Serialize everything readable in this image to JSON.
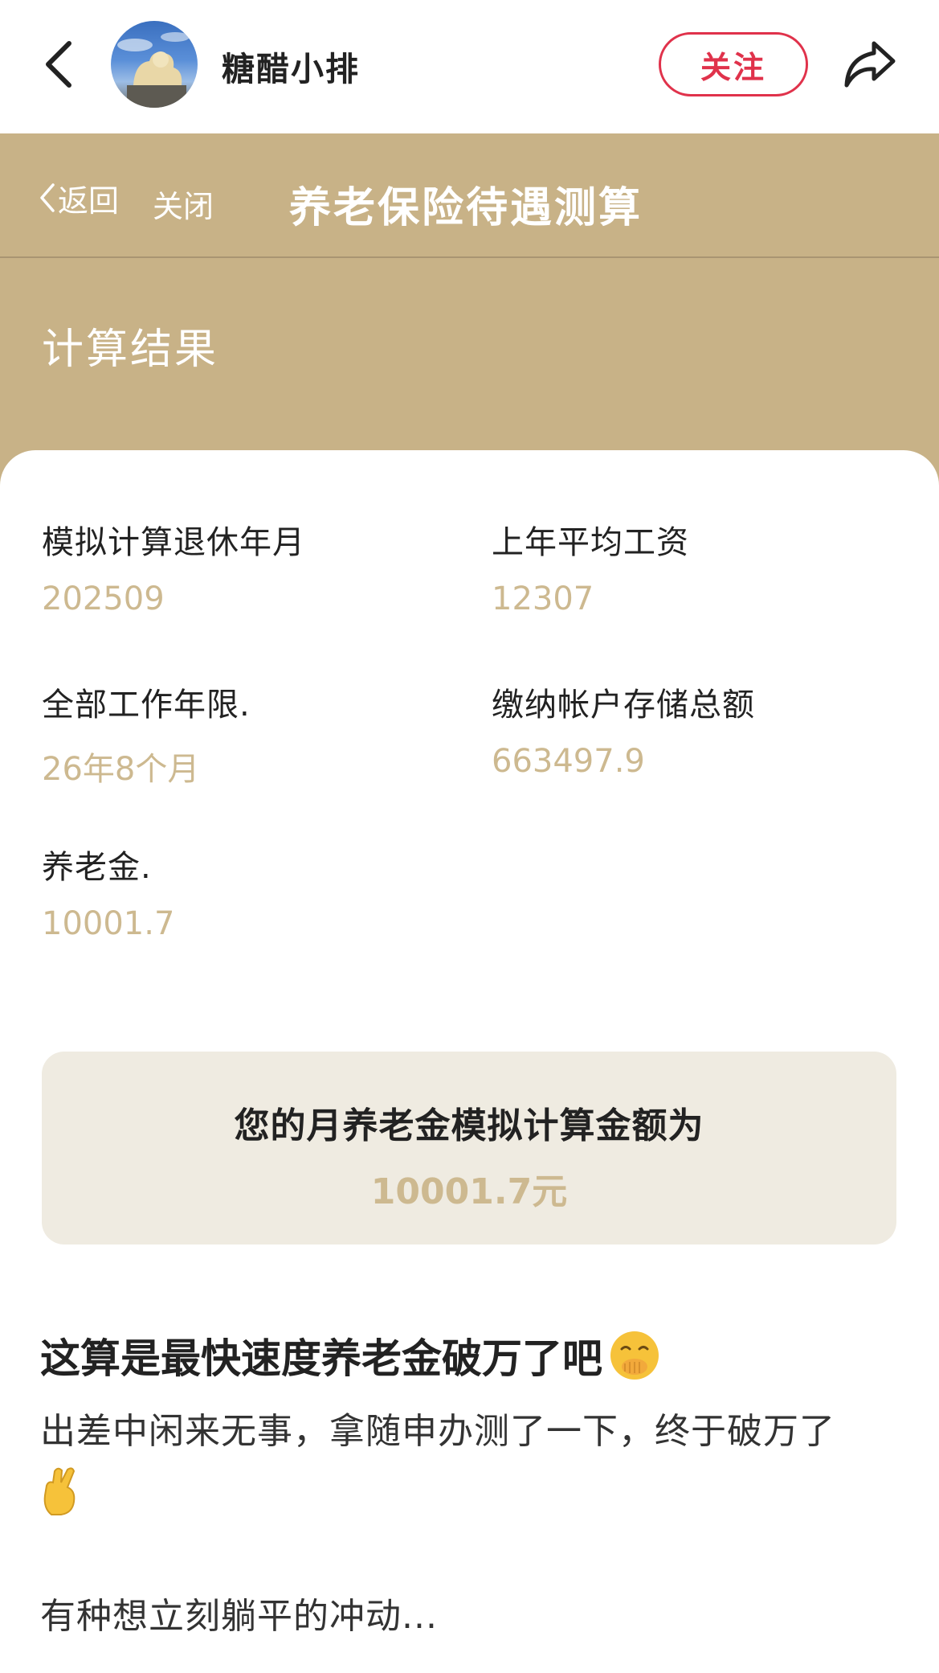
{
  "topbar": {
    "username": "糖醋小排",
    "follow_label": "关注"
  },
  "web_header": {
    "back_label": "返回",
    "close_label": "关闭",
    "title": "养老保险待遇测算",
    "section_title": "计算结果"
  },
  "results": {
    "fields": [
      {
        "label": "模拟计算退休年月",
        "value": "202509"
      },
      {
        "label": "上年平均工资",
        "value": "12307"
      },
      {
        "label": "全部工作年限.",
        "value": "26年8个月"
      },
      {
        "label": "缴纳帐户存储总额",
        "value": "663497.9"
      },
      {
        "label": "养老金.",
        "value": "10001.7"
      }
    ],
    "summary_label": "您的月养老金模拟计算金额为",
    "summary_value": "10001.7元"
  },
  "post": {
    "title": "这算是最快速度养老金破万了吧",
    "body": "出差中闲来无事，拿随申办测了一下，终于破万了",
    "footer": "有种想立刻躺平的冲动..."
  },
  "icons": {
    "back": "chevron-left-icon",
    "share": "share-arrow-icon",
    "title_emoji": "hand-over-mouth-emoji",
    "body_emoji": "crossed-fingers-emoji"
  },
  "colors": {
    "accent_gold": "#c8b287",
    "value_gold": "#cdb990",
    "follow_red": "#e0324b",
    "result_bg": "#efebe1"
  }
}
